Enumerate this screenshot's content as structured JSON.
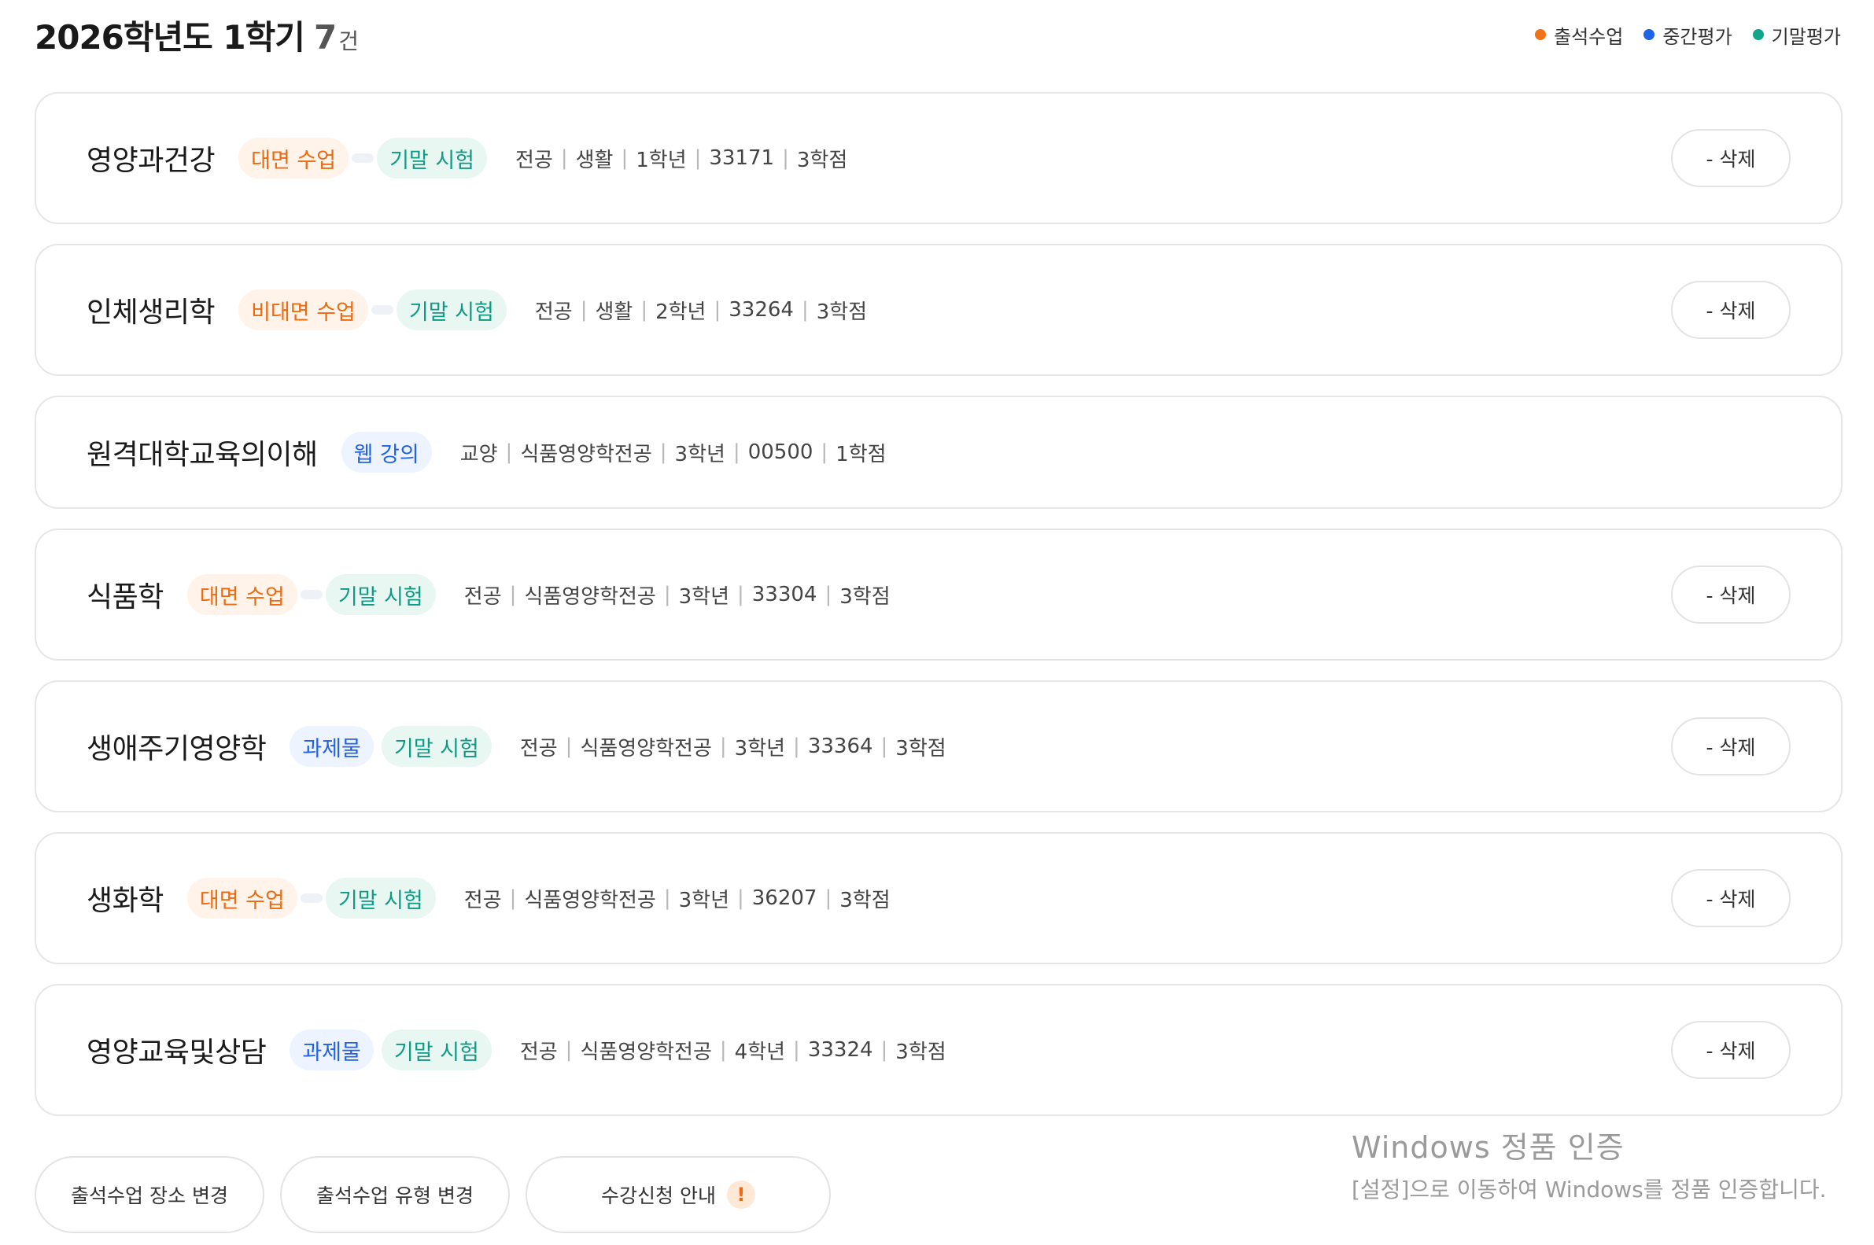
{
  "header": {
    "title": "2026학년도 1학기",
    "count": "7",
    "count_unit": "건",
    "legend": [
      {
        "label": "출석수업",
        "color": "#f07317"
      },
      {
        "label": "중간평가",
        "color": "#1f63e6"
      },
      {
        "label": "기말평가",
        "color": "#12a58c"
      }
    ]
  },
  "courses": [
    {
      "name": "영양과건강",
      "badges": [
        {
          "label": "대면 수업",
          "type": "orange"
        },
        {
          "label": "기말 시험",
          "type": "green"
        }
      ],
      "meta": [
        "전공",
        "생활",
        "1학년",
        "33171",
        "3학점"
      ],
      "delete_label": "- 삭제"
    },
    {
      "name": "인체생리학",
      "badges": [
        {
          "label": "비대면 수업",
          "type": "orange"
        },
        {
          "label": "기말 시험",
          "type": "green"
        }
      ],
      "meta": [
        "전공",
        "생활",
        "2학년",
        "33264",
        "3학점"
      ],
      "delete_label": "- 삭제"
    },
    {
      "name": "원격대학교육의이해",
      "badges": [
        {
          "label": "웹 강의",
          "type": "blue"
        }
      ],
      "meta": [
        "교양",
        "식품영양학전공",
        "3학년",
        "00500",
        "1학점"
      ],
      "delete_label": ""
    },
    {
      "name": "식품학",
      "badges": [
        {
          "label": "대면 수업",
          "type": "orange"
        },
        {
          "label": "기말 시험",
          "type": "green"
        }
      ],
      "meta": [
        "전공",
        "식품영양학전공",
        "3학년",
        "33304",
        "3학점"
      ],
      "delete_label": "- 삭제"
    },
    {
      "name": "생애주기영양학",
      "badges": [
        {
          "label": "과제물",
          "type": "blue"
        },
        {
          "label": "기말 시험",
          "type": "green"
        }
      ],
      "meta": [
        "전공",
        "식품영양학전공",
        "3학년",
        "33364",
        "3학점"
      ],
      "delete_label": "- 삭제"
    },
    {
      "name": "생화학",
      "badges": [
        {
          "label": "대면 수업",
          "type": "orange"
        },
        {
          "label": "기말 시험",
          "type": "green"
        }
      ],
      "meta": [
        "전공",
        "식품영양학전공",
        "3학년",
        "36207",
        "3학점"
      ],
      "delete_label": "- 삭제"
    },
    {
      "name": "영양교육및상담",
      "badges": [
        {
          "label": "과제물",
          "type": "blue"
        },
        {
          "label": "기말 시험",
          "type": "green"
        }
      ],
      "meta": [
        "전공",
        "식품영양학전공",
        "4학년",
        "33324",
        "3학점"
      ],
      "delete_label": "- 삭제"
    }
  ],
  "bottom_buttons": {
    "change_place": "출석수업 장소 변경",
    "change_type": "출석수업 유형 변경",
    "guide": "수강신청 안내",
    "guide_icon": "!"
  },
  "watermark": {
    "title": "Windows 정품 인증",
    "subtitle": "[설정]으로 이동하여 Windows를 정품 인증합니다."
  }
}
